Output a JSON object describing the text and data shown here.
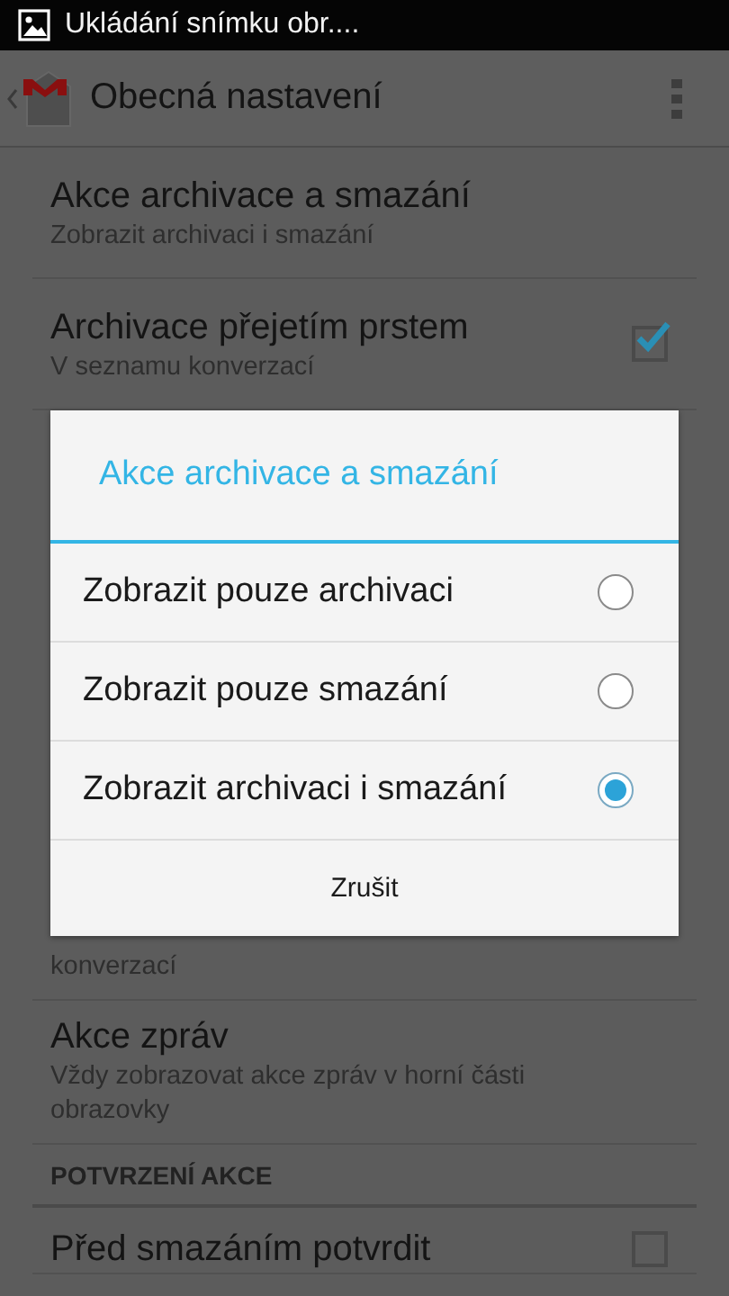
{
  "status_bar": {
    "notification": "Ukládání snímku obr...."
  },
  "action_bar": {
    "title": "Obecná nastavení"
  },
  "settings_top": [
    {
      "kind": "text",
      "title": "Akce archivace a smazání",
      "subtitle": "Zobrazit archivaci i smazání"
    },
    {
      "kind": "checkbox",
      "title": "Archivace přejetím prstem",
      "subtitle": "V seznamu konverzací",
      "checked": true
    }
  ],
  "settings_bottom": [
    {
      "kind": "subtitle_only",
      "subtitle": "konverzací"
    },
    {
      "kind": "text",
      "title": "Akce zpráv",
      "subtitle": "Vždy zobrazovat akce zpráv v horní části obrazovky"
    },
    {
      "kind": "header",
      "title": "POTVRZENÍ AKCE"
    },
    {
      "kind": "checkbox",
      "title": "Před smazáním potvrdit",
      "checked": false
    }
  ],
  "dialog": {
    "title": "Akce archivace a smazání",
    "options": [
      {
        "label": "Zobrazit pouze archivaci",
        "selected": false
      },
      {
        "label": "Zobrazit pouze smazání",
        "selected": false
      },
      {
        "label": "Zobrazit archivaci i smazání",
        "selected": true
      }
    ],
    "cancel": "Zrušit"
  }
}
